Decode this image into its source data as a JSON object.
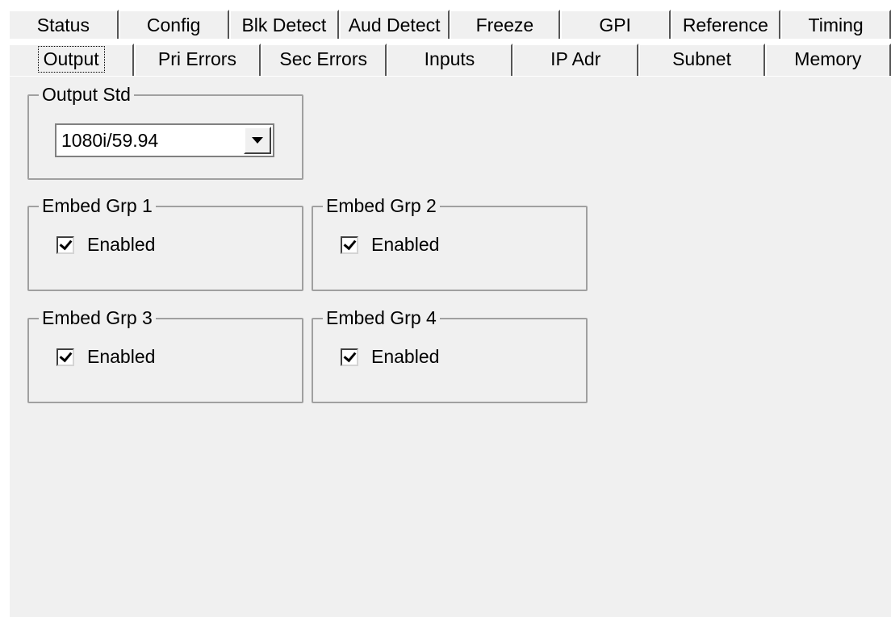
{
  "tabs_back": [
    "Status",
    "Config",
    "Blk Detect",
    "Aud Detect",
    "Freeze",
    "GPI",
    "Reference",
    "Timing"
  ],
  "tabs_front": [
    "Output",
    "Pri Errors",
    "Sec Errors",
    "Inputs",
    "IP Adr",
    "Subnet",
    "Memory"
  ],
  "active_tab": "Output",
  "output_std": {
    "title": "Output Std",
    "value": "1080i/59.94"
  },
  "embed_groups": [
    {
      "title": "Embed Grp 1",
      "checkbox_label": "Enabled",
      "checked": true
    },
    {
      "title": "Embed Grp 2",
      "checkbox_label": "Enabled",
      "checked": true
    },
    {
      "title": "Embed Grp 3",
      "checkbox_label": "Enabled",
      "checked": true
    },
    {
      "title": "Embed Grp 4",
      "checkbox_label": "Enabled",
      "checked": true
    }
  ],
  "colors": {
    "panel_bg": "#f0f0f0",
    "group_border": "#a0a0a0"
  }
}
